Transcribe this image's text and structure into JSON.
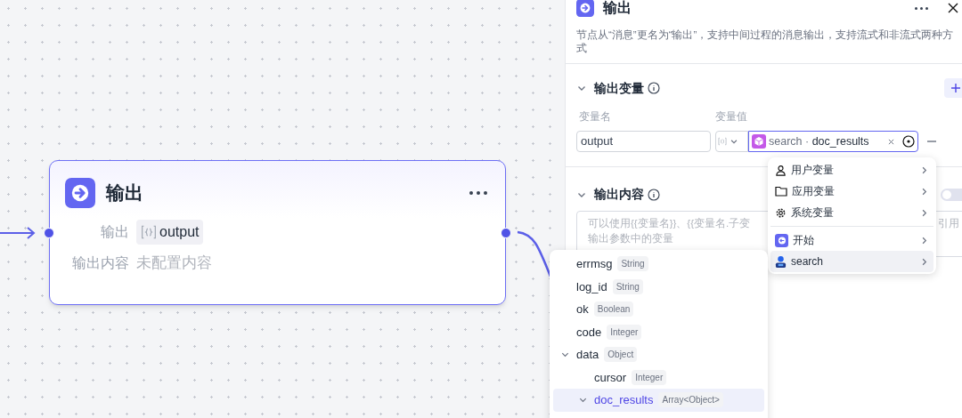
{
  "canvas": {
    "node": {
      "title": "输出",
      "fields": [
        {
          "label": "输出",
          "value": "output",
          "kind": "variable"
        },
        {
          "label": "输出内容",
          "value": "未配置内容",
          "kind": "empty"
        }
      ]
    }
  },
  "panel": {
    "title": "输出",
    "description": "节点从“消息”更名为“输出”，支持中间过程的消息输出，支持流式和非流式两种方式",
    "variables": {
      "title": "输出变量",
      "expanded": true,
      "columns": [
        "变量名",
        "变量值"
      ],
      "rows": [
        {
          "name": "output",
          "source": "search",
          "separator": "·",
          "field": "doc_results"
        }
      ]
    },
    "content": {
      "title": "输出内容",
      "expanded": true,
      "streaming": false,
      "placeholder_start": "可以使用{{变量名}}、{{变量名.子变",
      "placeholder_end": "引用",
      "placeholder_line2": "输出参数中的变量"
    }
  },
  "menu": {
    "groups": [
      [
        {
          "kind": "user",
          "label": "用户变量",
          "selected": false
        },
        {
          "kind": "app",
          "label": "应用变量",
          "selected": false
        },
        {
          "kind": "system",
          "label": "系统变量",
          "selected": false
        }
      ],
      [
        {
          "kind": "start",
          "label": "开始",
          "selected": false
        },
        {
          "kind": "plugin",
          "label": "search",
          "selected": true
        }
      ]
    ]
  },
  "tree": [
    {
      "name": "errmsg",
      "type": "String"
    },
    {
      "name": "log_id",
      "type": "String"
    },
    {
      "name": "ok",
      "type": "Boolean"
    },
    {
      "name": "code",
      "type": "Integer"
    },
    {
      "name": "data",
      "type": "Object",
      "expanded": true,
      "selected": false,
      "children": [
        {
          "name": "cursor",
          "type": "Integer"
        },
        {
          "name": "doc_results",
          "type": "Array<Object>",
          "expanded": true,
          "selected": true
        }
      ]
    }
  ]
}
